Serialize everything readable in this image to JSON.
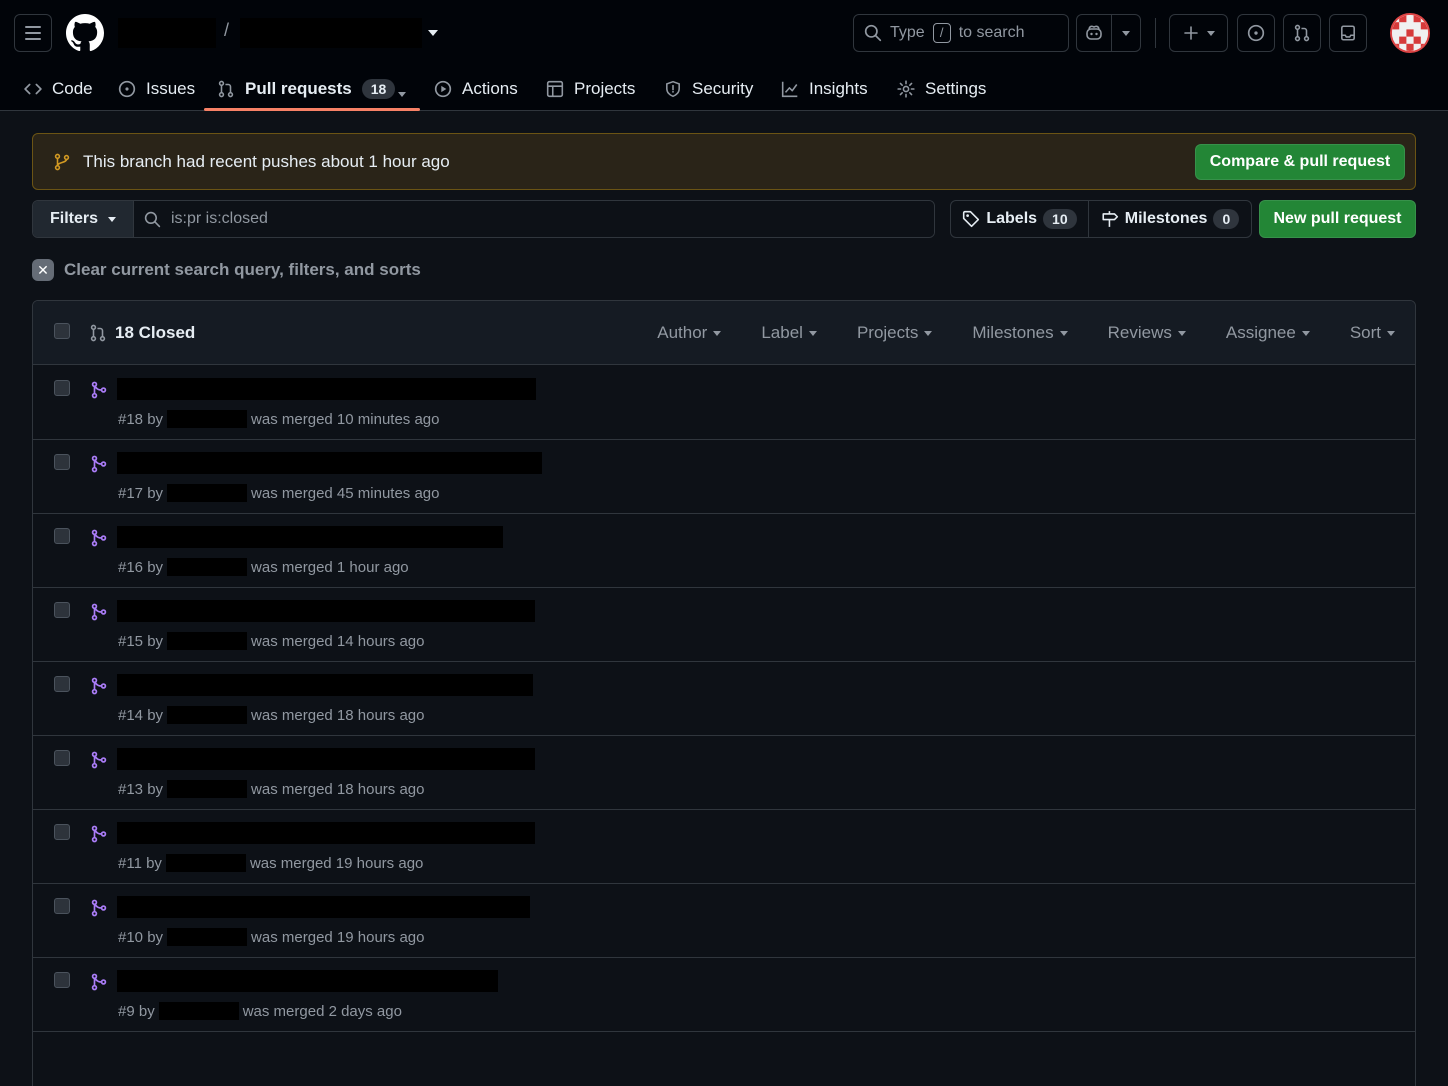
{
  "header": {
    "search_prefix": "Type",
    "search_key": "/",
    "search_suffix": "to search"
  },
  "tabs": [
    {
      "label": "Code",
      "icon": "code-icon"
    },
    {
      "label": "Issues",
      "icon": "issue-icon"
    },
    {
      "label": "Pull requests",
      "icon": "pull-request-icon",
      "count": "18",
      "selected": true
    },
    {
      "label": "Actions",
      "icon": "play-icon"
    },
    {
      "label": "Projects",
      "icon": "table-icon"
    },
    {
      "label": "Security",
      "icon": "shield-icon"
    },
    {
      "label": "Insights",
      "icon": "graph-icon"
    },
    {
      "label": "Settings",
      "icon": "gear-icon"
    }
  ],
  "banner": {
    "text": "This branch had recent pushes about 1 hour ago",
    "button": "Compare & pull request"
  },
  "filters": {
    "button": "Filters",
    "query": "is:pr is:closed",
    "labels_label": "Labels",
    "labels_count": "10",
    "milestones_label": "Milestones",
    "milestones_count": "0",
    "new_pr": "New pull request",
    "clear_text": "Clear current search query, filters, and sorts"
  },
  "list": {
    "closed_label": "18 Closed",
    "header_filters": [
      "Author",
      "Label",
      "Projects",
      "Milestones",
      "Reviews",
      "Assignee",
      "Sort"
    ],
    "rows": [
      {
        "num": "#18",
        "status": "was merged 10 minutes ago"
      },
      {
        "num": "#17",
        "status": "was merged 45 minutes ago"
      },
      {
        "num": "#16",
        "status": "was merged 1 hour ago"
      },
      {
        "num": "#15",
        "status": "was merged 14 hours ago"
      },
      {
        "num": "#14",
        "status": "was merged 18 hours ago"
      },
      {
        "num": "#13",
        "status": "was merged 18 hours ago"
      },
      {
        "num": "#11",
        "status": "was merged 19 hours ago"
      },
      {
        "num": "#10",
        "status": "was merged 19 hours ago"
      },
      {
        "num": "#9",
        "status": "was merged 2 days ago"
      }
    ],
    "by_word": "by"
  },
  "colors": {
    "accent_underline": "#f78166",
    "merged_purple": "#ab7df8",
    "green_button": "#238636"
  }
}
